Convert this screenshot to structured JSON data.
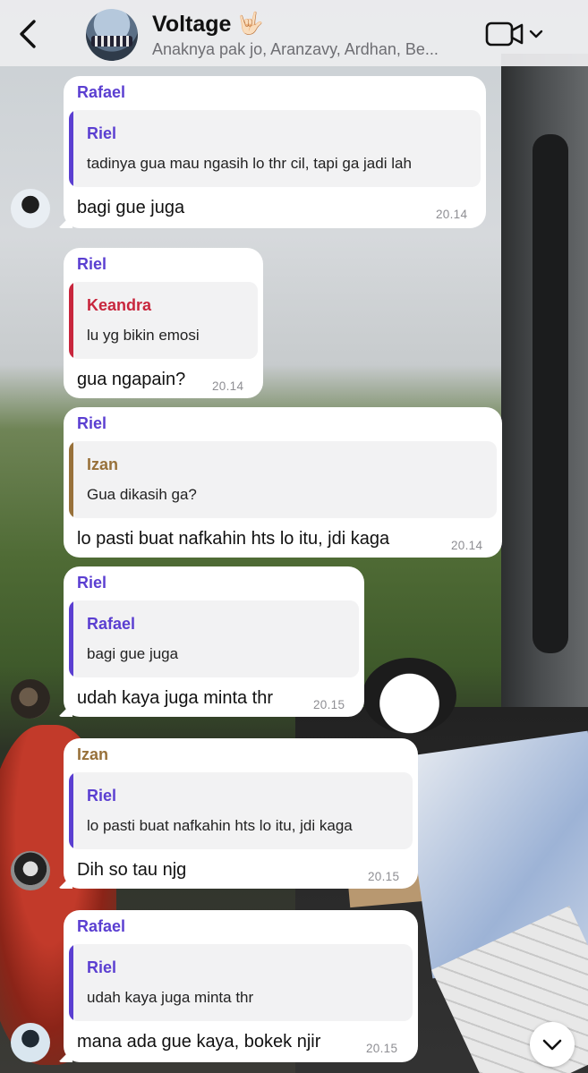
{
  "header": {
    "back_icon": "chevron-left-icon",
    "title": "Voltage",
    "title_emoji": "🤟🏻",
    "subtitle": "Anaknya pak jo, Aranzavy, Ardhan, Be...",
    "video_icon": "video-camera-icon",
    "dropdown_icon": "chevron-down-icon"
  },
  "colors": {
    "purple": "#5b3fd1",
    "red": "#c8263d",
    "gold": "#98713a",
    "bubble": "#ffffff",
    "quote_bg": "#f2f2f3"
  },
  "messages": [
    {
      "sender": "Rafael",
      "quote": {
        "name": "Riel",
        "text": "tadinya gua mau ngasih lo thr cil, tapi ga jadi lah"
      },
      "text": "bagi gue juga",
      "time": "20.14"
    },
    {
      "sender": "Riel",
      "quote": {
        "name": "Keandra",
        "text": "lu yg bikin emosi"
      },
      "text": "gua ngapain?",
      "time": "20.14"
    },
    {
      "sender": "Riel",
      "quote": {
        "name": "Izan",
        "text": "Gua dikasih ga?"
      },
      "text": "lo pasti buat nafkahin hts lo itu, jdi kaga",
      "time": "20.14"
    },
    {
      "sender": "Riel",
      "quote": {
        "name": "Rafael",
        "text": "bagi gue juga"
      },
      "text": "udah kaya juga minta thr",
      "time": "20.15"
    },
    {
      "sender": "Izan",
      "quote": {
        "name": "Riel",
        "text": "lo pasti buat nafkahin hts lo itu, jdi kaga"
      },
      "text": "Dih so tau njg",
      "time": "20.15"
    },
    {
      "sender": "Rafael",
      "quote": {
        "name": "Riel",
        "text": "udah kaya juga minta thr"
      },
      "text": "mana ada gue kaya, bokek njir",
      "time": "20.15"
    }
  ],
  "scroll_down_icon": "chevron-down-icon"
}
